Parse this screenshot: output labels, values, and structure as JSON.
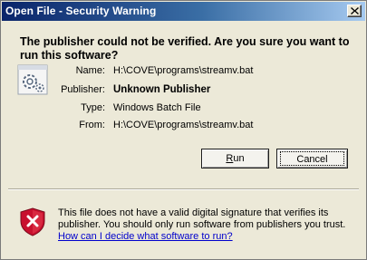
{
  "window": {
    "title": "Open File - Security Warning",
    "close_glyph": "×"
  },
  "headline": "The publisher could not be verified.  Are you sure you want to run this software?",
  "details": {
    "name_label": "Name:",
    "name_value": "H:\\COVE\\programs\\streamv.bat",
    "publisher_label": "Publisher:",
    "publisher_value": "Unknown Publisher",
    "type_label": "Type:",
    "type_value": "Windows Batch File",
    "from_label": "From:",
    "from_value": "H:\\COVE\\programs\\streamv.bat"
  },
  "buttons": {
    "run_label_accel": "R",
    "run_label_rest": "un",
    "cancel_label": "Cancel"
  },
  "warning": {
    "text": "This file does not have a valid digital signature that verifies its publisher.  You should only run software from publishers you trust.",
    "help_link": "How can I decide what software to run?"
  },
  "icons": {
    "file": "batch-file-icon",
    "shield": "security-shield-icon",
    "close": "close-icon"
  },
  "colors": {
    "titlebar_start": "#0a246a",
    "titlebar_end": "#a6caf0",
    "dialog_bg": "#ece9d8",
    "link": "#0000cc",
    "shield_red": "#c8102e"
  }
}
